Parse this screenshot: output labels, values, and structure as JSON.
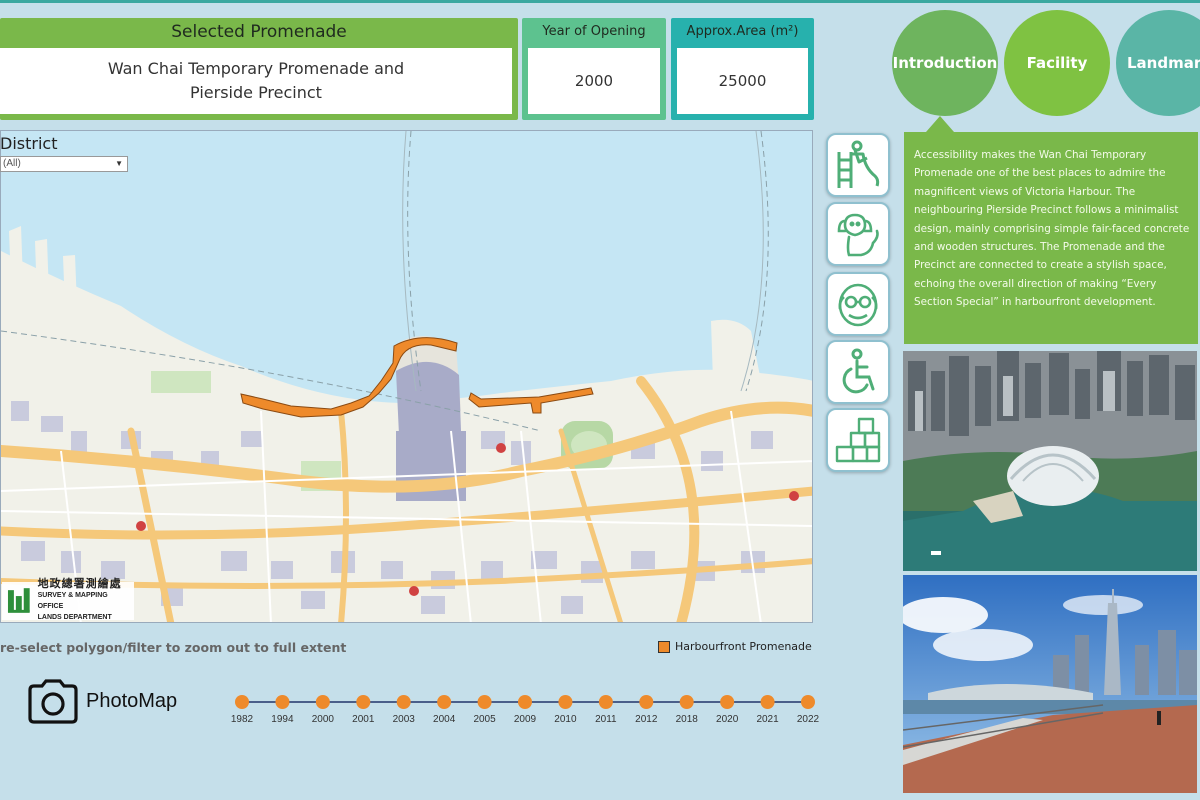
{
  "header": {
    "promenade_title": "Selected Promenade",
    "promenade_name_line1": "Wan Chai Temporary Promenade and",
    "promenade_name_line2": "Pierside Precinct",
    "year_title": "Year of Opening",
    "year_value": "2000",
    "area_title": "Approx.Area (m²)",
    "area_value": "25000"
  },
  "tabs": [
    {
      "label": "Introduction"
    },
    {
      "label": "Facility"
    },
    {
      "label": "Landmark"
    }
  ],
  "intro_text": "Accessibility makes the Wan Chai Temporary Promenade one of the best places to admire the magnificent views of Victoria Harbour. The neighbouring Pierside Precinct follows a minimalist design, mainly comprising simple fair-faced concrete and wooden structures. The Promenade and the Precinct are connected to create a stylish space, echoing the overall direction of making “Every Section Special” in harbourfront development.",
  "filter": {
    "label": "District",
    "selected": "(All)"
  },
  "map_logo": {
    "chinese": "地政總署測繪處",
    "english_line1": "SURVEY & MAPPING OFFICE",
    "english_line2": "LANDS DEPARTMENT"
  },
  "hint": "re-select polygon/filter to zoom out to full extent",
  "legend": {
    "label": "Harbourfront Promenade",
    "color": "#ee8a2b"
  },
  "photomap_label": "PhotoMap",
  "facility_icons": [
    "playground-icon",
    "pet-dog-icon",
    "elderly-face-icon",
    "wheelchair-icon",
    "fitness-blocks-icon"
  ],
  "timeline": {
    "years": [
      "1982",
      "1994",
      "2000",
      "2001",
      "2003",
      "2004",
      "2005",
      "2009",
      "2010",
      "2011",
      "2012",
      "2018",
      "2020",
      "2021",
      "2022"
    ],
    "dot_color": "#ee8a2b",
    "line_color": "#4a5f8a"
  },
  "colors": {
    "promenade_box": "#7ab84a",
    "year_box": "#5dc28f",
    "area_box": "#27b1ad",
    "promenade_shape": "#ee8a2b"
  }
}
